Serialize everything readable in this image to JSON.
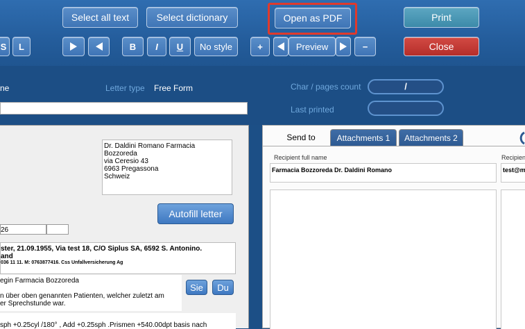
{
  "toolbar": {
    "row1": {
      "select_all_text": "Select all text",
      "select_dictionary": "Select dictionary",
      "open_as_pdf": "Open as PDF",
      "print": "Print"
    },
    "row2": {
      "s_label": "S",
      "l_label": "L",
      "bold": "B",
      "italic": "I",
      "underline": "U",
      "no_style": "No style",
      "plus": "+",
      "preview": "Preview",
      "minus": "−",
      "close": "Close"
    }
  },
  "infobar": {
    "name_label_partial": "ne",
    "letter_type_label": "Letter type",
    "letter_type_value": "Free Form",
    "char_pages_label": "Char / pages count",
    "char_pages_value": "/",
    "last_printed_label": "Last printed",
    "last_printed_value": ""
  },
  "left": {
    "address_lines": [
      "Dr. Daldini Romano Farmacia",
      "Bozzoreda",
      "via Ceresio 43",
      "6963 Pregassona",
      "Schweiz"
    ],
    "autofill_label": "Autofill letter",
    "field_value": "26",
    "patient_line1": "ster, 21.09.1955, Via test 18,  C/O Siplus SA, 6592 S. Antonino.",
    "patient_line2": "and",
    "patient_line3": "036 11 11. M: 0763877416.  Css Unfallversicherung Ag",
    "greeting": "egin Farmacia Bozzoreda",
    "body_line1": "n über oben genannten Patienten, welcher zuletzt am",
    "body_line2": "er Sprechstunde war.",
    "sie_label": "Sie",
    "du_label": "Du",
    "rx_line": "sph  +0.25cyl /180° , Add +0.25sph .Prismen +540.00dpt  basis  nach"
  },
  "right": {
    "tabs": [
      {
        "label": "Send to",
        "active": true
      },
      {
        "label": "Attachments 1",
        "active": false
      },
      {
        "label": "Attachments 2",
        "active": false
      }
    ],
    "recipient_name_header": "Recipient full name",
    "recipient_name_value": "Farmacia Bozzoreda Dr. Daldini Romano",
    "recipient_email_header": "Recipien",
    "recipient_email_value": "test@m"
  }
}
